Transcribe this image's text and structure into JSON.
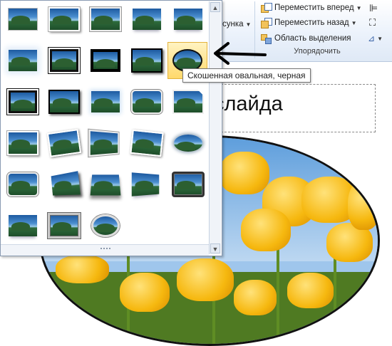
{
  "ribbon": {
    "partial_label": "сунка",
    "bring_forward": "Переместить вперед",
    "send_backward": "Переместить назад",
    "selection_pane": "Область выделения",
    "group_label": "Упорядочить"
  },
  "slide": {
    "title_text": "слайда"
  },
  "gallery": {
    "hovered_style_tooltip": "Скошенная овальная, черная",
    "scroll_up": "▲",
    "scroll_down": "▼"
  },
  "colors": {
    "hover_fill": "#ffd96b",
    "ribbon_bg": "#eaf1fb",
    "annotation_arrow": "#000000"
  }
}
